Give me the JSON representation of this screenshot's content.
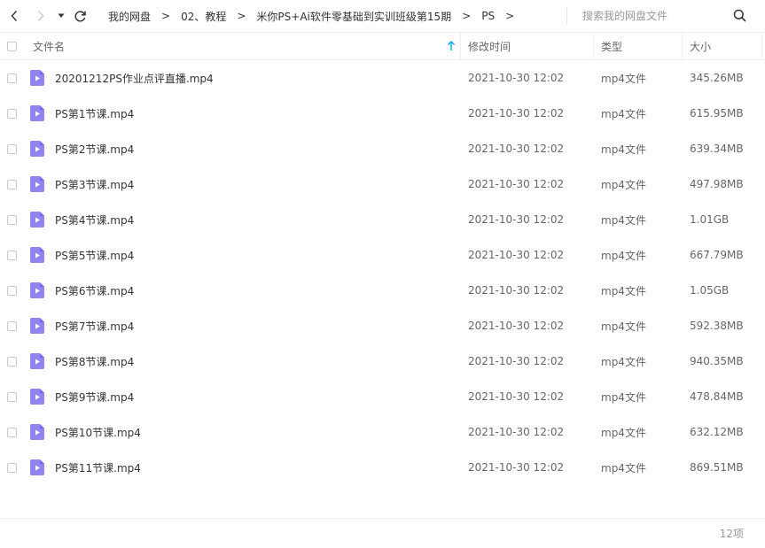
{
  "nav": {
    "back_icon": "chevron-left-icon",
    "forward_icon": "chevron-right-icon",
    "dropdown_icon": "caret-down-icon",
    "refresh_icon": "refresh-icon"
  },
  "breadcrumb": [
    "我的网盘",
    "02、教程",
    "米你PS+Ai软件零基础到实训班级第15期",
    "PS"
  ],
  "search": {
    "placeholder": "搜索我的网盘文件",
    "icon": "search-icon"
  },
  "columns": {
    "name": "文件名",
    "modified": "修改时间",
    "type": "类型",
    "size": "大小"
  },
  "files": [
    {
      "name": "20201212PS作业点评直播.mp4",
      "modified": "2021-10-30 12:02",
      "type": "mp4文件",
      "size": "345.26MB"
    },
    {
      "name": "PS第1节课.mp4",
      "modified": "2021-10-30 12:02",
      "type": "mp4文件",
      "size": "615.95MB"
    },
    {
      "name": "PS第2节课.mp4",
      "modified": "2021-10-30 12:02",
      "type": "mp4文件",
      "size": "639.34MB"
    },
    {
      "name": "PS第3节课.mp4",
      "modified": "2021-10-30 12:02",
      "type": "mp4文件",
      "size": "497.98MB"
    },
    {
      "name": "PS第4节课.mp4",
      "modified": "2021-10-30 12:02",
      "type": "mp4文件",
      "size": "1.01GB"
    },
    {
      "name": "PS第5节课.mp4",
      "modified": "2021-10-30 12:02",
      "type": "mp4文件",
      "size": "667.79MB"
    },
    {
      "name": "PS第6节课.mp4",
      "modified": "2021-10-30 12:02",
      "type": "mp4文件",
      "size": "1.05GB"
    },
    {
      "name": "PS第7节课.mp4",
      "modified": "2021-10-30 12:02",
      "type": "mp4文件",
      "size": "592.38MB"
    },
    {
      "name": "PS第8节课.mp4",
      "modified": "2021-10-30 12:02",
      "type": "mp4文件",
      "size": "940.35MB"
    },
    {
      "name": "PS第9节课.mp4",
      "modified": "2021-10-30 12:02",
      "type": "mp4文件",
      "size": "478.84MB"
    },
    {
      "name": "PS第10节课.mp4",
      "modified": "2021-10-30 12:02",
      "type": "mp4文件",
      "size": "632.12MB"
    },
    {
      "name": "PS第11节课.mp4",
      "modified": "2021-10-30 12:02",
      "type": "mp4文件",
      "size": "869.51MB"
    }
  ],
  "footer": {
    "count": "12项"
  },
  "colors": {
    "accent": "#06a7ff",
    "file_icon": "#8f86f0",
    "file_icon_dark": "#6f64e6"
  }
}
